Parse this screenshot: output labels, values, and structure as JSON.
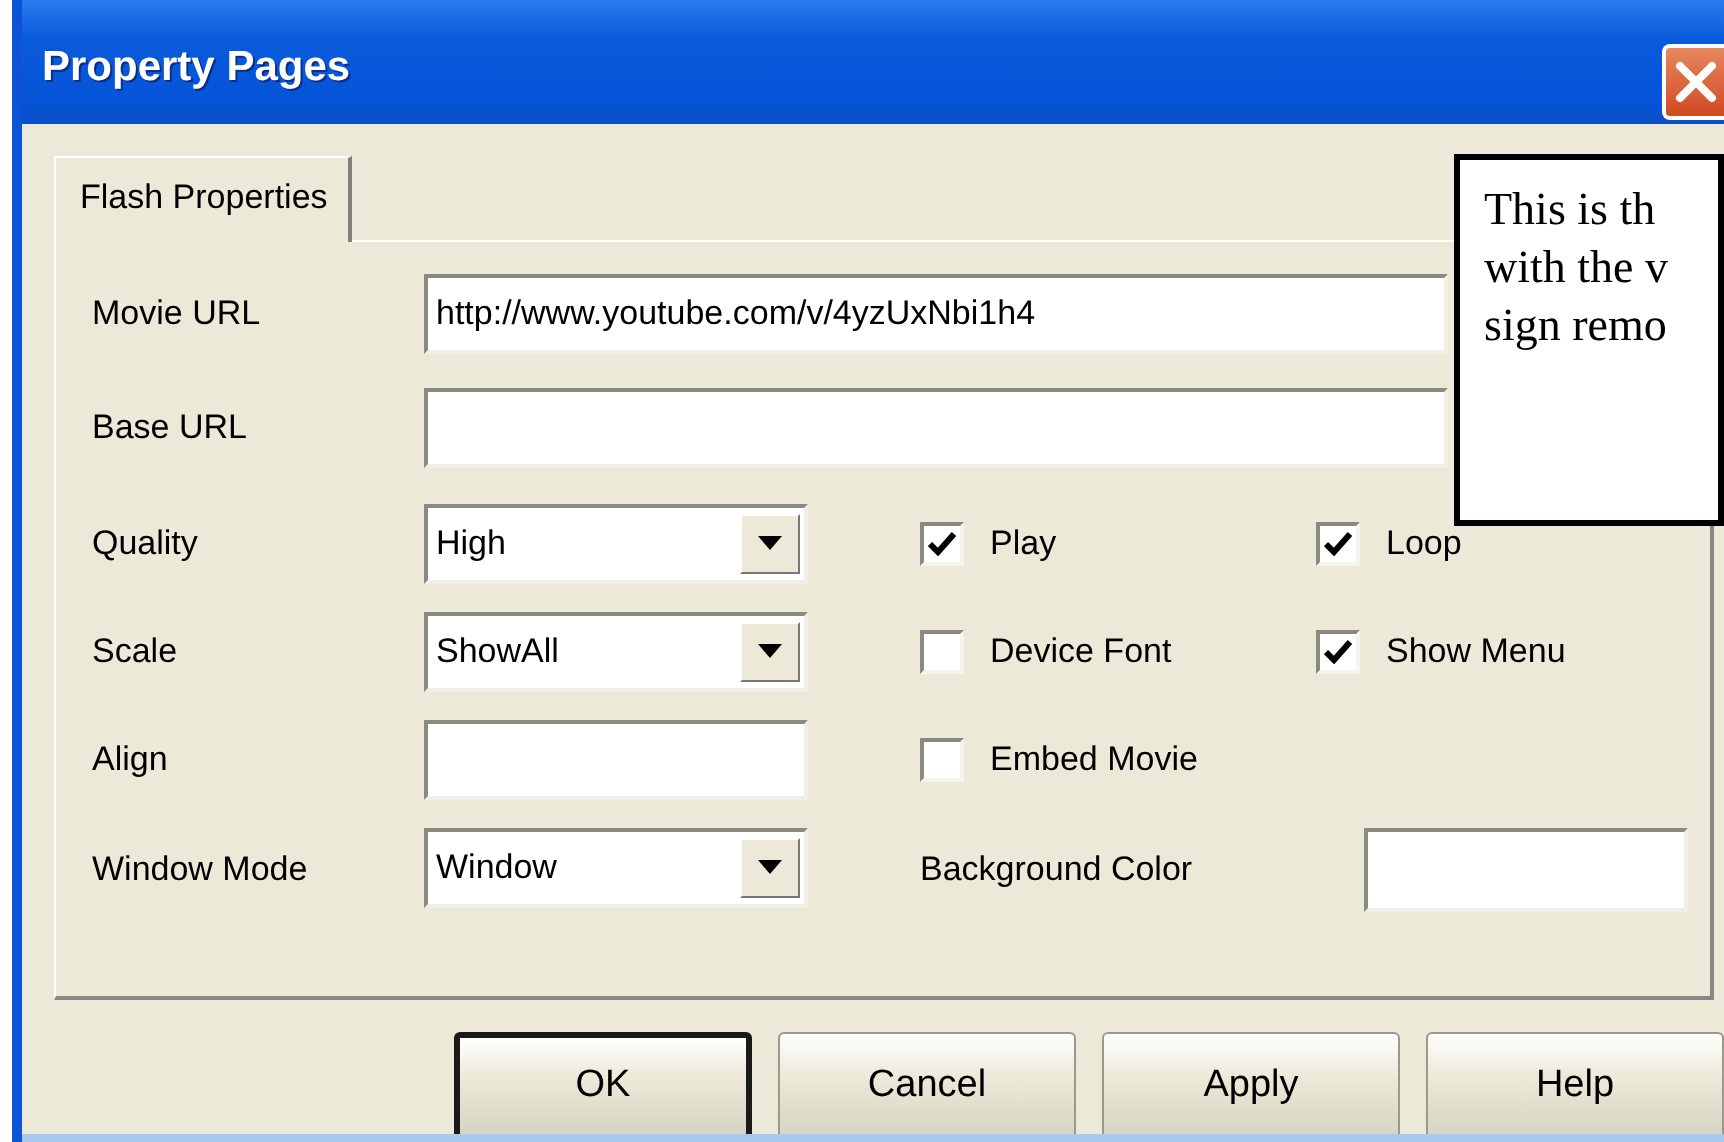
{
  "window": {
    "title": "Property Pages"
  },
  "tabs": [
    {
      "label": "Flash Properties",
      "selected": true
    }
  ],
  "url_fields": [
    {
      "label": "Movie URL",
      "value": "http://www.youtube.com/v/4yzUxNbi1h4"
    },
    {
      "label": "Base URL"
    }
  ],
  "settings": [
    {
      "label": "Quality",
      "kind": "combo",
      "value": "High"
    },
    {
      "label": "Scale",
      "kind": "combo",
      "value": "ShowAll"
    },
    {
      "label": "Align",
      "kind": "text"
    },
    {
      "label": "Window Mode",
      "kind": "combo",
      "value": "Window"
    }
  ],
  "checkboxes": [
    {
      "label": "Play",
      "checked": true
    },
    {
      "label": "Loop",
      "checked": true
    },
    {
      "label": "Device Font",
      "checked": false
    },
    {
      "label": "Show Menu",
      "checked": true
    },
    {
      "label": "Embed Movie",
      "checked": false
    }
  ],
  "background_color": {
    "label": "Background Color"
  },
  "buttons": [
    {
      "label": "OK",
      "default": true
    },
    {
      "label": "Cancel",
      "default": false
    },
    {
      "label": "Apply",
      "default": false
    },
    {
      "label": "Help",
      "default": false
    }
  ],
  "note": {
    "lines": [
      "This is th",
      "with the v",
      "sign remo"
    ]
  }
}
